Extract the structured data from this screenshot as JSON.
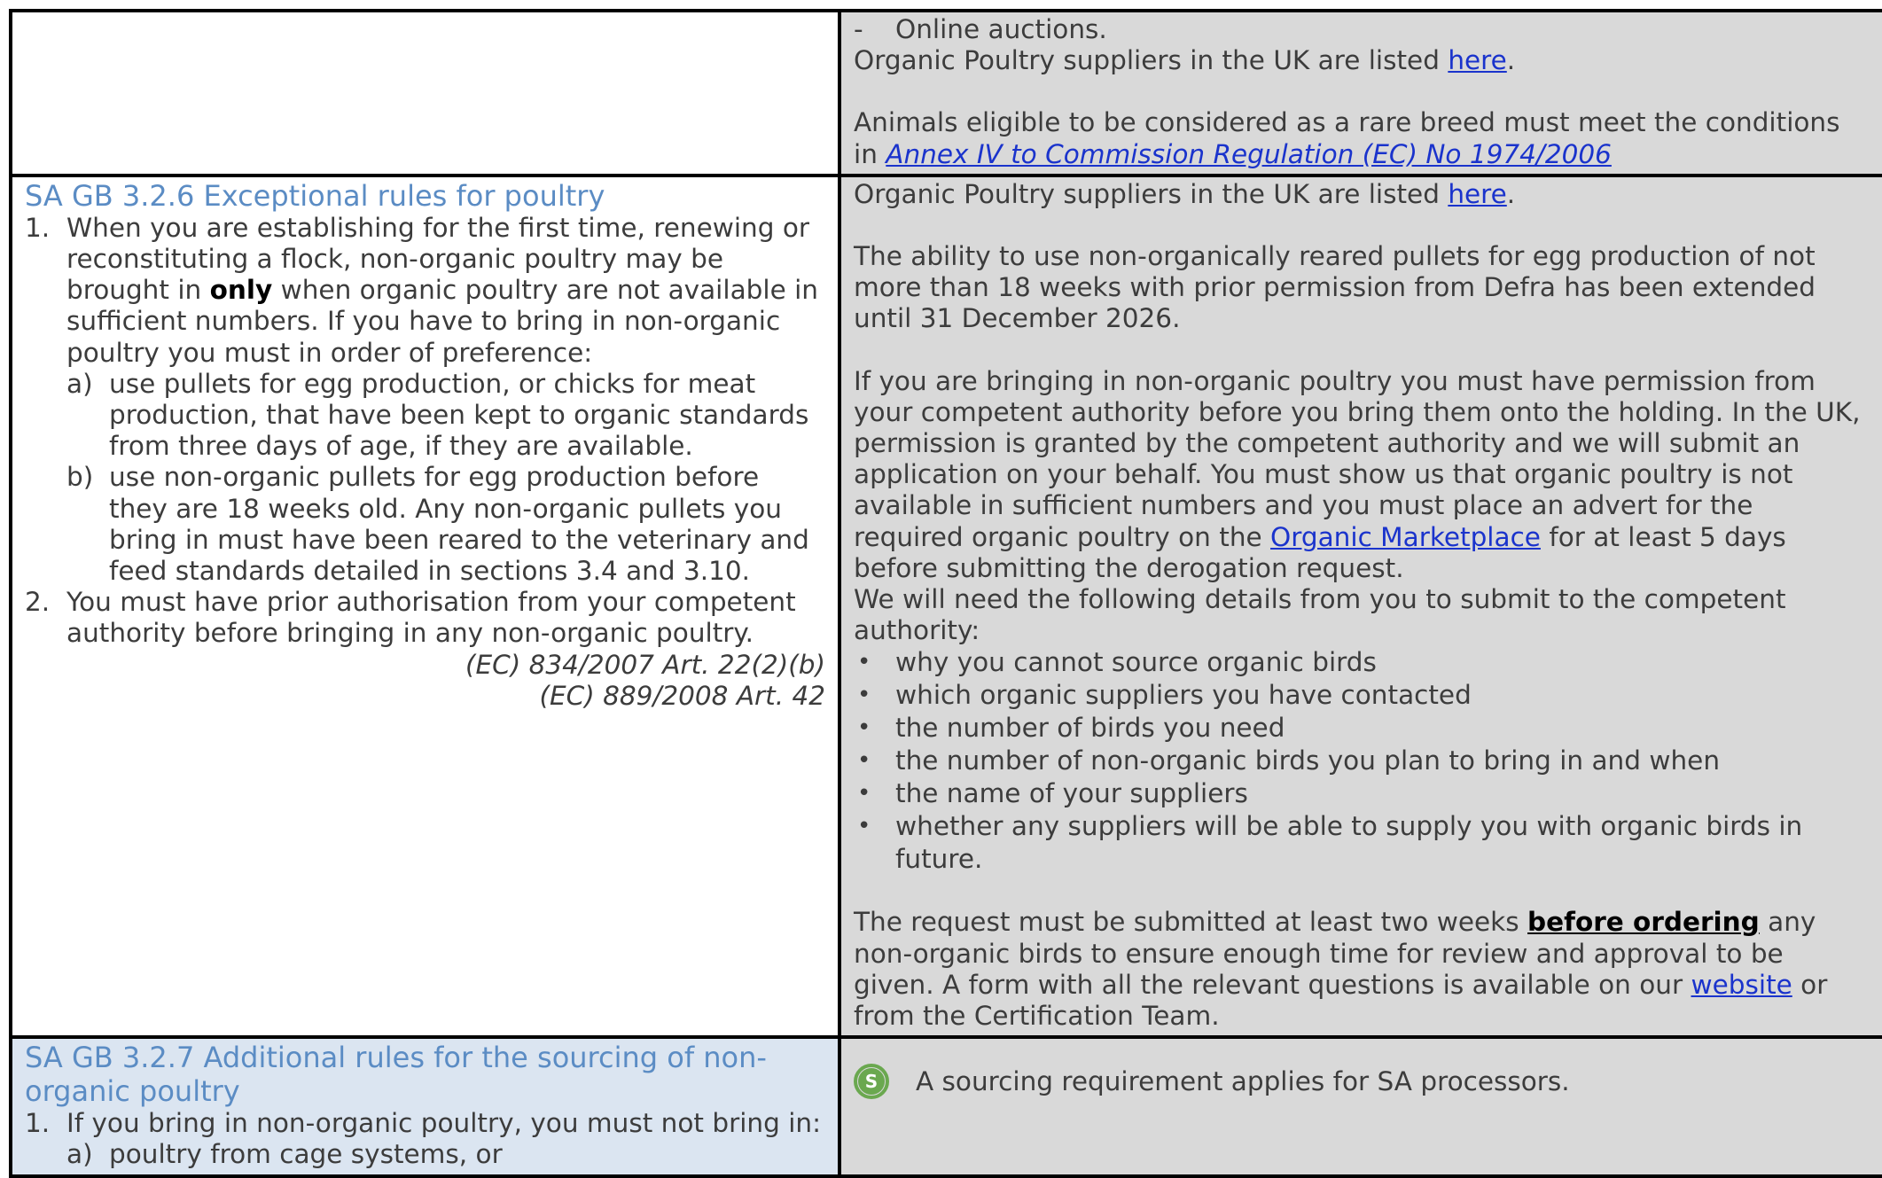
{
  "row1": {
    "right": {
      "dash_item": "Online auctions.",
      "dash_marker": "-",
      "suppliers_text": "Organic Poultry suppliers in the UK are listed ",
      "suppliers_link": "here",
      "suppliers_end": ".",
      "rare_breed_text": "Animals eligible to be considered as a rare breed must meet the conditions in ",
      "rare_breed_link": "Annex IV to Commission Regulation (EC) No 1974/2006 "
    }
  },
  "row2": {
    "left": {
      "heading": "SA GB 3.2.6 Exceptional rules for poultry",
      "item1_marker": "1.",
      "item1_pre": "When you are establishing for the first time, renewing or reconstituting a flock, non-organic poultry may be brought in ",
      "item1_bold": "only",
      "item1_post": " when organic poultry are not available in sufficient numbers. If you have to bring in non-organic poultry you must in order of preference:",
      "sub_a_marker": "a)",
      "sub_a": "use pullets for egg production, or chicks for meat production, that have been kept to organic standards from three days of age, if they are available.",
      "sub_b_marker": "b)",
      "sub_b": "use non-organic pullets for egg production before they are 18 weeks old.  Any non-organic pullets you bring in must have been reared to the veterinary and feed standards detailed in sections 3.4 and 3.10.",
      "item2_marker": "2.",
      "item2": "You must have prior authorisation from your competent authority before bringing in any non-organic poultry.",
      "ref1": "(EC) 834/2007 Art. 22(2)(b)",
      "ref2": "(EC) 889/2008 Art. 42"
    },
    "right": {
      "suppliers_text": "Organic Poultry suppliers in the UK are listed ",
      "suppliers_link": "here",
      "suppliers_end": ".",
      "pullets_para": "The ability to use non-organically reared pullets for egg production of not more than 18 weeks with prior permission from Defra has been extended until 31 December 2026.",
      "permission_pre": "If you are bringing in non-organic poultry you must have permission from your competent authority before you bring them onto the holding. In the UK, permission is granted by the competent authority and we will submit an application on your behalf.  You must show us that organic poultry is not available in sufficient numbers and you must place an advert for the required organic poultry on the ",
      "marketplace_link": "Organic Marketplace",
      "permission_post": " for at least 5 days before submitting the derogation request.",
      "details_intro": "We will need the following details from you to submit to the competent authority:",
      "bullet_marker": "•",
      "bullets": [
        "why you cannot source organic birds",
        "which organic suppliers you have contacted",
        "the number of birds you need",
        "the number of non-organic birds you plan to bring in and when",
        "the name of your suppliers",
        "whether any suppliers will be able to supply you with organic birds in future."
      ],
      "request_pre": "The request must be submitted at least two weeks ",
      "request_bold": "before ordering",
      "request_post": " any non-organic birds to ensure enough time for review and approval to be given. A form with all the relevant questions is available on our ",
      "website_link": "website",
      "request_end": " or from the Certification Team."
    }
  },
  "row3": {
    "left": {
      "heading": "SA GB 3.2.7 Additional rules for the sourcing of non-organic poultry",
      "item1_marker": "1.",
      "item1": "If you bring in non-organic poultry, you must not bring in:",
      "sub_a_marker": "a)",
      "sub_a": "poultry from cage systems, or"
    },
    "right": {
      "icon_letter": "S",
      "sourcing_text": "A sourcing requirement applies for SA processors."
    }
  },
  "colors": {
    "heading": "#5b8cc4",
    "guidance_bg": "#d9d9d9",
    "standard_blue_bg": "#dbe5f1",
    "link": "#1a33cc",
    "sourcing_icon": "#6aa84f"
  }
}
